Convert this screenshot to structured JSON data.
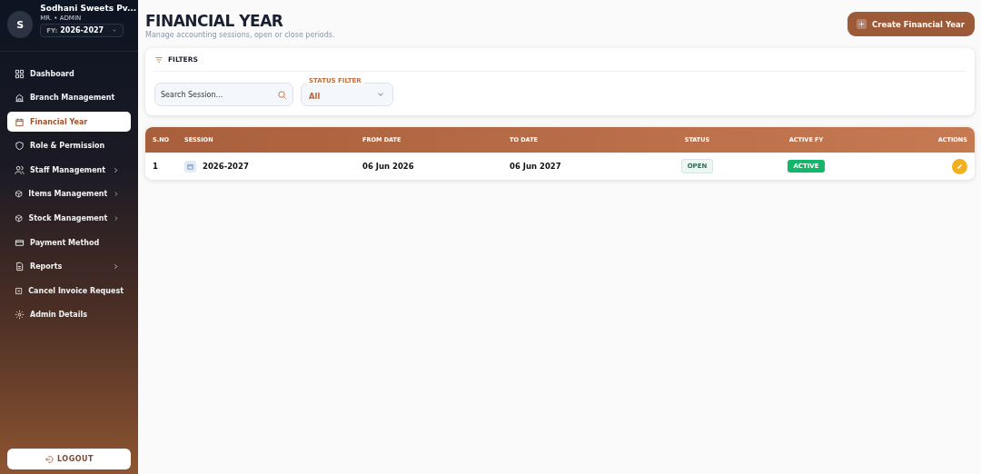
{
  "sidebar": {
    "avatar": "S",
    "company": "Sodhani Sweets Pv...",
    "role": "MR. • ADMIN",
    "fy_label": "FY:",
    "fy_value": "2026-2027",
    "items": [
      {
        "label": "Dashboard",
        "selected": false,
        "has_submenu": false
      },
      {
        "label": "Branch Management",
        "selected": false,
        "has_submenu": false
      },
      {
        "label": "Financial Year",
        "selected": true,
        "has_submenu": false
      },
      {
        "label": "Role & Permission",
        "selected": false,
        "has_submenu": false
      },
      {
        "label": "Staff Management",
        "selected": false,
        "has_submenu": true
      },
      {
        "label": "Items Management",
        "selected": false,
        "has_submenu": true
      },
      {
        "label": "Stock Management",
        "selected": false,
        "has_submenu": true
      },
      {
        "label": "Payment Method",
        "selected": false,
        "has_submenu": false
      },
      {
        "label": "Reports",
        "selected": false,
        "has_submenu": true
      },
      {
        "label": "Cancel Invoice Request",
        "selected": false,
        "has_submenu": false
      },
      {
        "label": "Admin Details",
        "selected": false,
        "has_submenu": false
      }
    ],
    "logout": "LOGOUT"
  },
  "header": {
    "title": "FINANCIAL YEAR",
    "subtitle": "Manage accounting sessions, open or close periods.",
    "create_button": "Create Financial Year"
  },
  "filters": {
    "title": "FILTERS",
    "search": {
      "placeholder": "Search Session..."
    },
    "status_filter": {
      "label": "STATUS FILTER",
      "value": "All"
    }
  },
  "table": {
    "columns": [
      "S.NO",
      "SESSION",
      "FROM DATE",
      "TO DATE",
      "STATUS",
      "ACTIVE FY",
      "ACTIONS"
    ],
    "rows": [
      {
        "sno": "1",
        "session": "2026-2027",
        "from": "06 Jun 2026",
        "to": "06 Jun 2027",
        "status": "OPEN",
        "active_fy": "ACTIVE"
      }
    ]
  }
}
